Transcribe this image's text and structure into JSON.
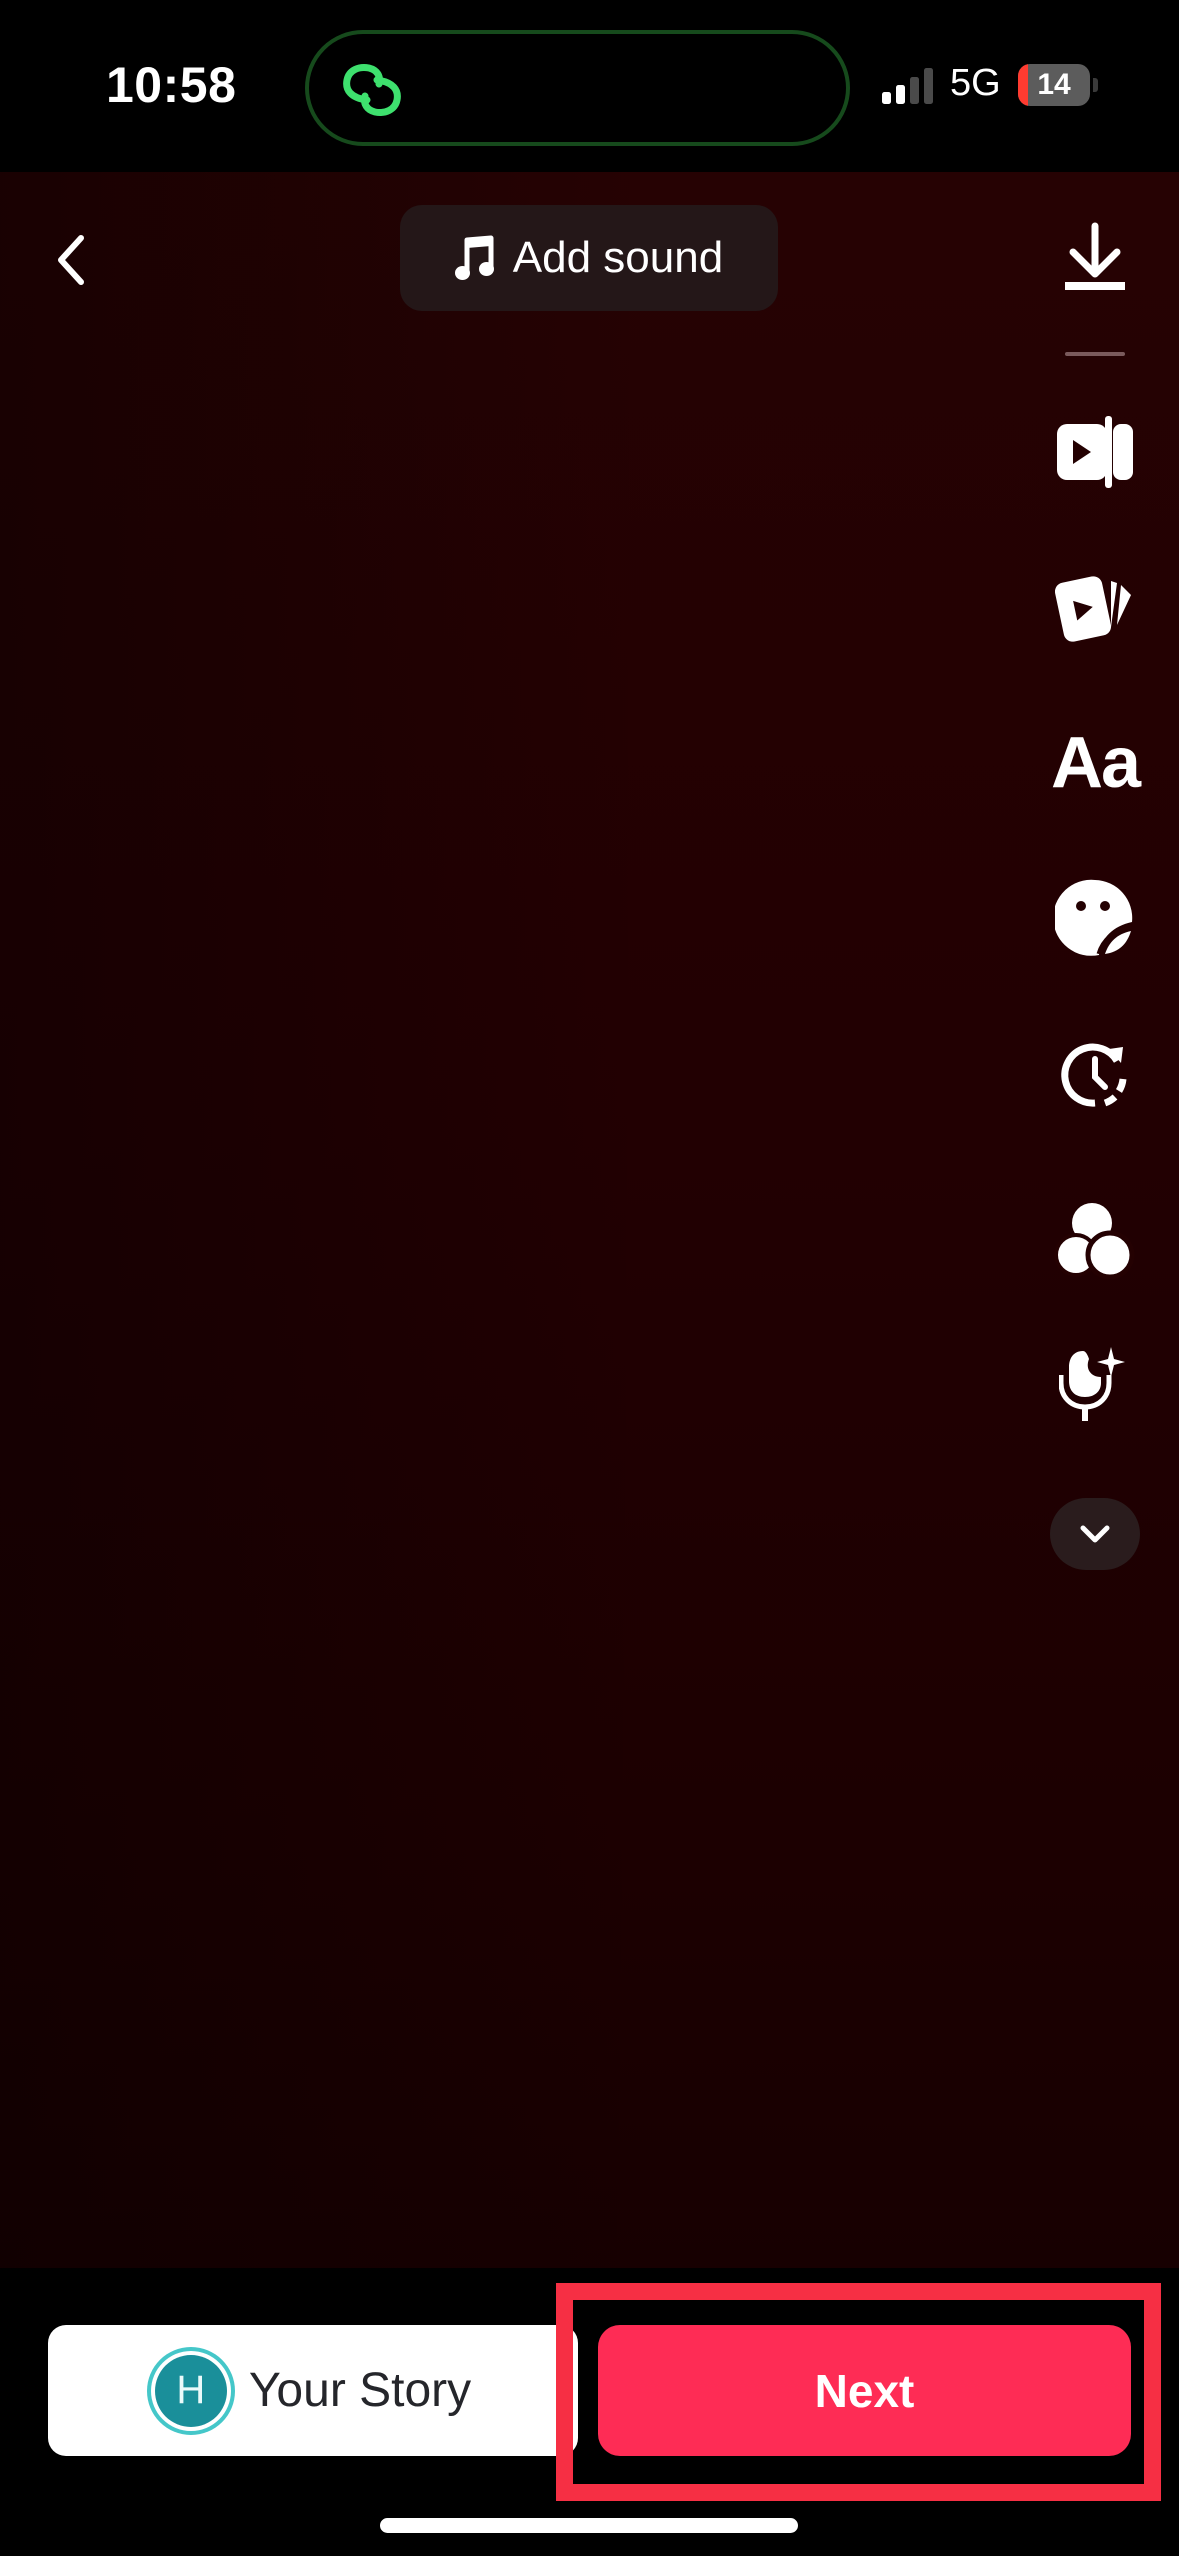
{
  "status_bar": {
    "time": "10:58",
    "network": "5G",
    "battery_level": "14",
    "battery_low_color": "#ff3b30",
    "island_icon": "link-icon",
    "island_accent": "#3ee06e"
  },
  "header": {
    "back_icon": "chevron-left-icon",
    "add_sound_icon": "music-note-icon",
    "add_sound_label": "Add sound"
  },
  "toolbar": {
    "items": [
      {
        "name": "download",
        "icon": "download-icon"
      },
      {
        "name": "edit-clips",
        "icon": "video-clip-split-icon"
      },
      {
        "name": "templates",
        "icon": "video-cards-icon"
      },
      {
        "name": "text",
        "icon": "text-icon",
        "label": "Aa"
      },
      {
        "name": "stickers",
        "icon": "sticker-icon"
      },
      {
        "name": "timer",
        "icon": "clock-refresh-icon"
      },
      {
        "name": "filters",
        "icon": "filters-circles-icon"
      },
      {
        "name": "voice-effects",
        "icon": "mic-sparkle-icon"
      },
      {
        "name": "more",
        "icon": "chevron-down-icon"
      }
    ]
  },
  "footer": {
    "your_story": {
      "avatar_initial": "H",
      "label": "Your Story",
      "avatar_color": "#1a8f9a"
    },
    "next": {
      "label": "Next",
      "color": "#fe2c55"
    },
    "highlight_color": "#f62f44"
  }
}
